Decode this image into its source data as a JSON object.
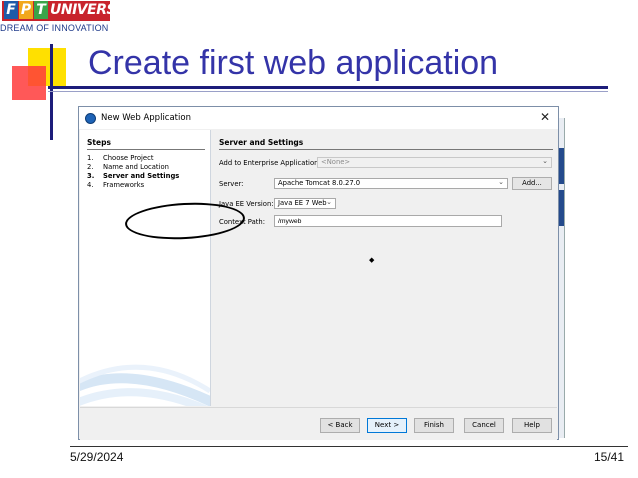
{
  "logo": {
    "letters": [
      "F",
      "P",
      "T"
    ],
    "university": "UNIVERSITY",
    "tagline": "DREAM OF INNOVATION"
  },
  "slide": {
    "title": "Create first web application",
    "date": "5/29/2024",
    "page": "15/41"
  },
  "colors": {
    "title": "#3434a8",
    "dialog_bg": "#f0f0f0",
    "primary_border": "#0078d7",
    "deco_yellow": "#ffe000",
    "deco_red": "#ff3b3b"
  },
  "dialog": {
    "title": "New Web Application",
    "close_glyph": "✕",
    "steps": {
      "heading": "Steps",
      "items": [
        {
          "num": "1.",
          "label": "Choose Project"
        },
        {
          "num": "2.",
          "label": "Name and Location"
        },
        {
          "num": "3.",
          "label": "Server and Settings"
        },
        {
          "num": "4.",
          "label": "Frameworks"
        }
      ]
    },
    "settings": {
      "heading": "Server and Settings",
      "enterprise_label": "Add to Enterprise Application:",
      "enterprise_value": "<None>",
      "server_label": "Server:",
      "server_value": "Apache Tomcat 8.0.27.0",
      "add_button": "Add...",
      "javaee_label": "Java EE Version:",
      "javaee_value": "Java EE 7 Web",
      "context_label": "Context Path:",
      "context_value": "/myweb"
    },
    "buttons": {
      "back": "< Back",
      "next": "Next >",
      "finish": "Finish",
      "cancel": "Cancel",
      "help": "Help"
    }
  }
}
